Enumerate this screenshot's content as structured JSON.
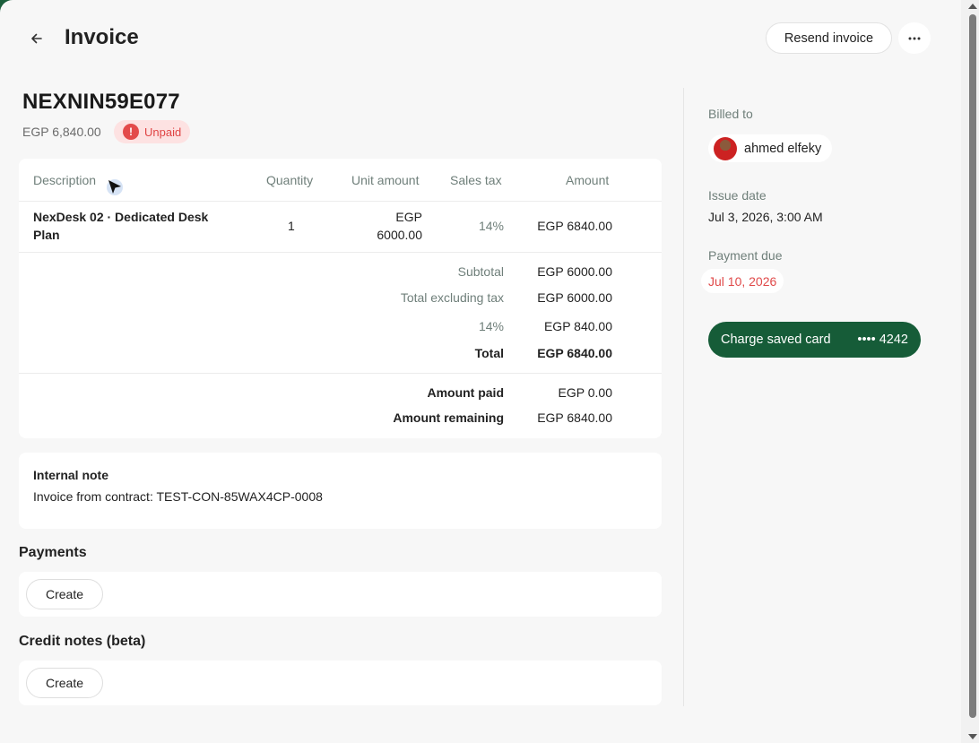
{
  "header": {
    "title": "Invoice",
    "resend_label": "Resend invoice"
  },
  "invoice": {
    "number": "NEXNIN59E077",
    "total_amount": "EGP 6,840.00",
    "status": "Unpaid",
    "status_icon": "!"
  },
  "table": {
    "headers": {
      "description": "Description",
      "quantity": "Quantity",
      "unit_amount": "Unit amount",
      "sales_tax": "Sales tax",
      "amount": "Amount"
    },
    "rows": [
      {
        "description_line1": "NexDesk 02 · Dedicated Desk",
        "description_line2": "Plan",
        "quantity": "1",
        "unit_amount_line1": "EGP",
        "unit_amount_line2": "6000.00",
        "sales_tax": "14%",
        "amount": "EGP 6840.00"
      }
    ],
    "totals": {
      "subtotal_label": "Subtotal",
      "subtotal_value": "EGP 6000.00",
      "excl_tax_label": "Total excluding tax",
      "excl_tax_value": "EGP 6000.00",
      "tax_label": "14%",
      "tax_value": "EGP 840.00",
      "total_label": "Total",
      "total_value": "EGP 6840.00"
    },
    "payments": {
      "paid_label": "Amount paid",
      "paid_value": "EGP 0.00",
      "remaining_label": "Amount remaining",
      "remaining_value": "EGP 6840.00"
    }
  },
  "note": {
    "title": "Internal note",
    "text": "Invoice from contract: TEST-CON-85WAX4CP-0008"
  },
  "payments_section": {
    "title": "Payments",
    "create_label": "Create"
  },
  "credit_notes_section": {
    "title": "Credit notes (beta)",
    "create_label": "Create"
  },
  "sidebar": {
    "billed_to_label": "Billed to",
    "customer_name": "ahmed elfeky",
    "issue_date_label": "Issue date",
    "issue_date": "Jul 3, 2026, 3:00 AM",
    "payment_due_label": "Payment due",
    "payment_due": "Jul 10, 2026",
    "charge_label": "Charge saved card",
    "card_last4": "•••• 4242"
  },
  "colors": {
    "brand_green": "#165c38",
    "unpaid_red": "#e04444",
    "unpaid_bg": "#fde2e2"
  },
  "icons": {
    "back": "arrow-left-icon",
    "more": "more-horizontal-icon",
    "status": "alert-circle-icon",
    "cursor": "mouse-pointer-icon"
  }
}
